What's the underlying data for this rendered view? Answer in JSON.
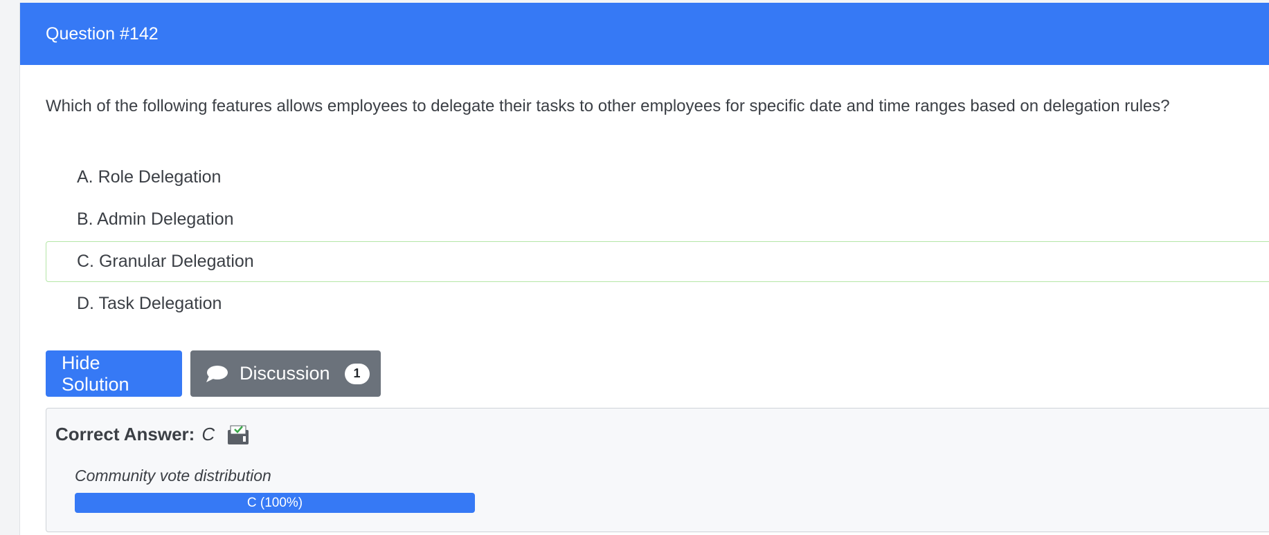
{
  "header": {
    "title": "Question #142"
  },
  "question": {
    "text": "Which of the following features allows employees to delegate their tasks to other employees for specific date and time ranges based on delegation rules?"
  },
  "choices": [
    {
      "label": "A. Role Delegation",
      "is_correct": false
    },
    {
      "label": "B. Admin Delegation",
      "is_correct": false
    },
    {
      "label": "C. Granular Delegation",
      "is_correct": true
    },
    {
      "label": "D. Task Delegation",
      "is_correct": false
    }
  ],
  "actions": {
    "hide_solution_label": "Hide Solution",
    "discussion_label": "Discussion",
    "discussion_count": "1",
    "discussion_icon": "chat-bubble-icon"
  },
  "solution": {
    "correct_answer_label": "Correct Answer:",
    "correct_answer_value": "C",
    "reveal_icon": "envelope-check-icon",
    "vote_title": "Community vote distribution",
    "vote_bars": [
      {
        "label": "C (100%)",
        "fraction": 1.0
      }
    ]
  },
  "colors": {
    "primary": "#3679f5",
    "secondary": "#6b727b",
    "correct_border": "#b4e6a6"
  }
}
